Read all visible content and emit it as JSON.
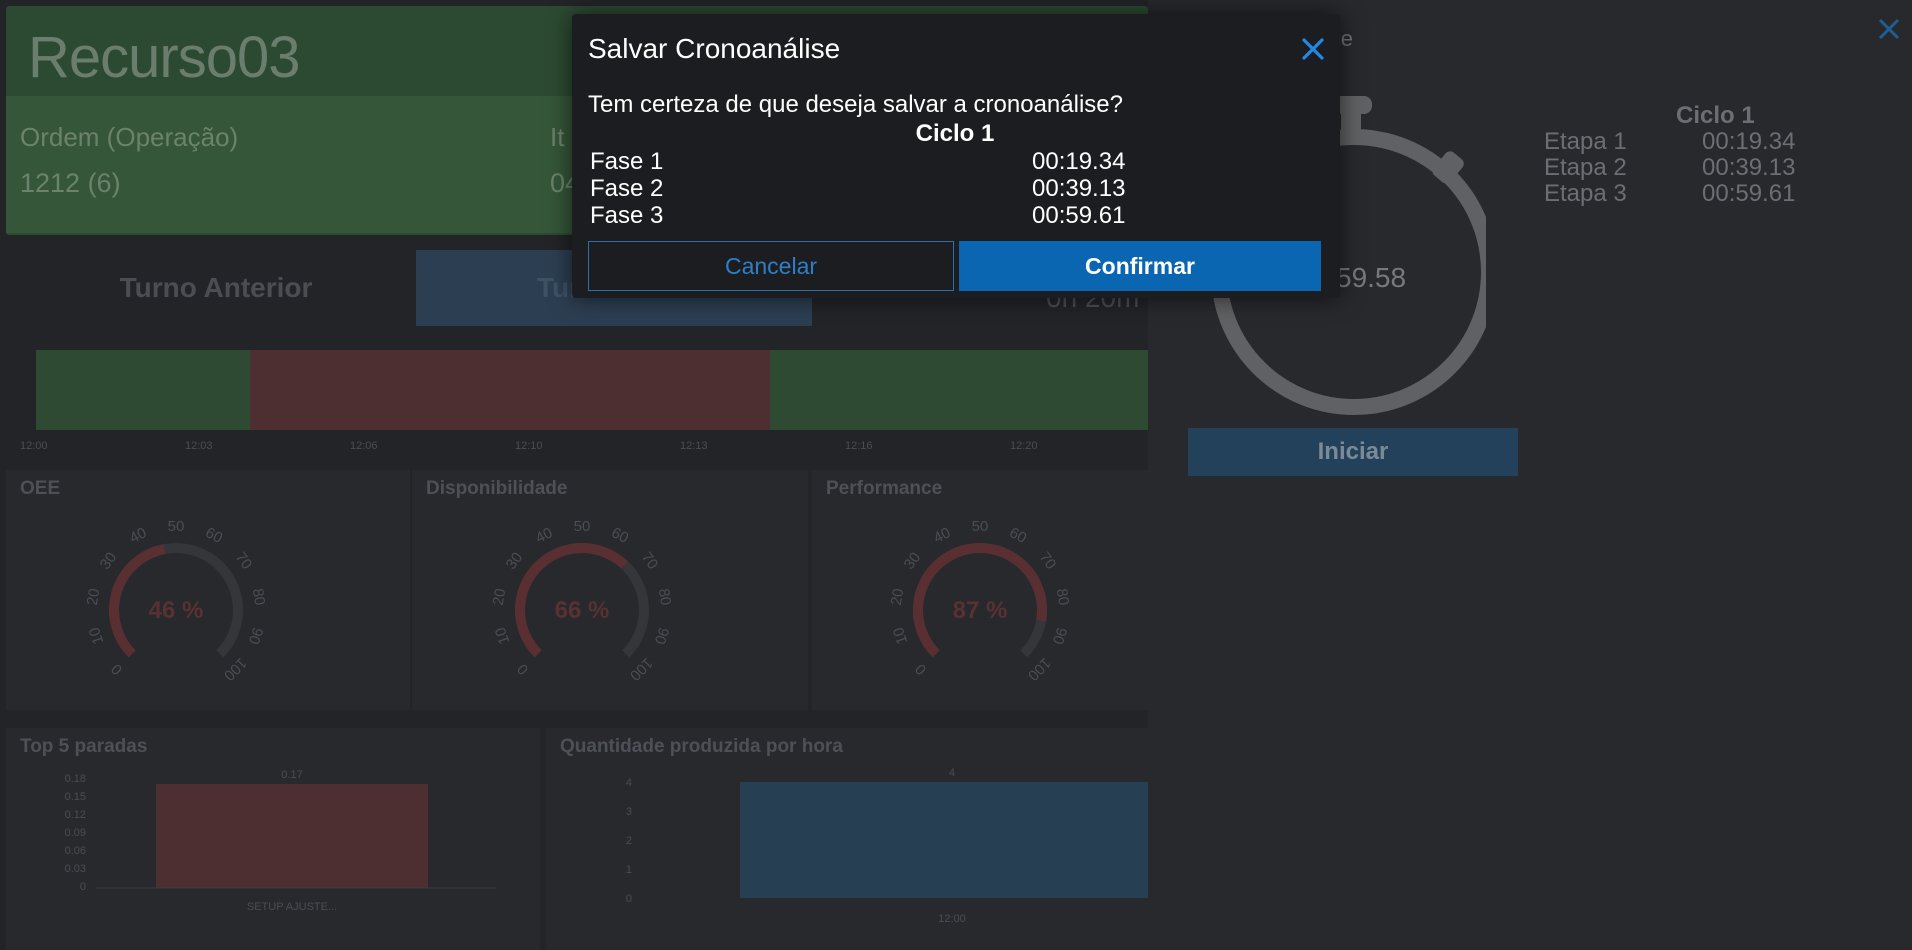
{
  "dashboard": {
    "resource_title": "Recurso03",
    "order_label": "Ordem (Operação)",
    "order_value": "1212 (6)",
    "item_label_partial": "It",
    "item_value_partial": "04",
    "turn_previous": "Turno Anterior",
    "turn_current_partial": "Turno Atual",
    "turn_duration_partial": "0h 20m",
    "timeline_ticks": [
      "12:00",
      "12:03",
      "12:06",
      "12:10",
      "12:13",
      "12:16",
      "12:20"
    ],
    "timeline_colors": {
      "run": "#2e4a32",
      "stop": "#4e2f31"
    },
    "gauges": [
      {
        "title": "OEE",
        "value": 46,
        "value_label": "46 %"
      },
      {
        "title": "Disponibilidade",
        "value": 66,
        "value_label": "66 %"
      },
      {
        "title": "Performance",
        "value": 87,
        "value_label": "87 %"
      }
    ],
    "gauge_scale": [
      "0",
      "10",
      "20",
      "30",
      "40",
      "50",
      "60",
      "70",
      "80",
      "90",
      "100"
    ],
    "stops_chart": {
      "title": "Top 5 paradas",
      "y_ticks": [
        "0.18",
        "0.15",
        "0.12",
        "0.09",
        "0.06",
        "0.03",
        "0"
      ],
      "bar_value": "0.17",
      "bar_label": "SETUP AJUSTE...",
      "color": "#4e2f31"
    },
    "production_chart": {
      "title": "Quantidade produzida por hora",
      "y_ticks": [
        "4",
        "3",
        "2",
        "1",
        "0"
      ],
      "bar_value": "4",
      "x_label": "12:00",
      "color": "#263f53"
    }
  },
  "side_panel": {
    "title_partial": "lise",
    "stopwatch_time_partial": "59.58",
    "start_button": "Iniciar",
    "cycle_title": "Ciclo 1",
    "steps": [
      {
        "label": "Etapa 1",
        "time": "00:19.34"
      },
      {
        "label": "Etapa 2",
        "time": "00:39.13"
      },
      {
        "label": "Etapa 3",
        "time": "00:59.61"
      }
    ]
  },
  "modal": {
    "title": "Salvar Cronoanálise",
    "question": "Tem certeza de que deseja salvar a cronoanálise?",
    "cycle_title": "Ciclo 1",
    "phases": [
      {
        "label": "Fase 1",
        "time": "00:19.34"
      },
      {
        "label": "Fase 2",
        "time": "00:39.13"
      },
      {
        "label": "Fase 3",
        "time": "00:59.61"
      }
    ],
    "cancel_label": "Cancelar",
    "confirm_label": "Confirmar",
    "accent_color": "#0b66b2"
  }
}
